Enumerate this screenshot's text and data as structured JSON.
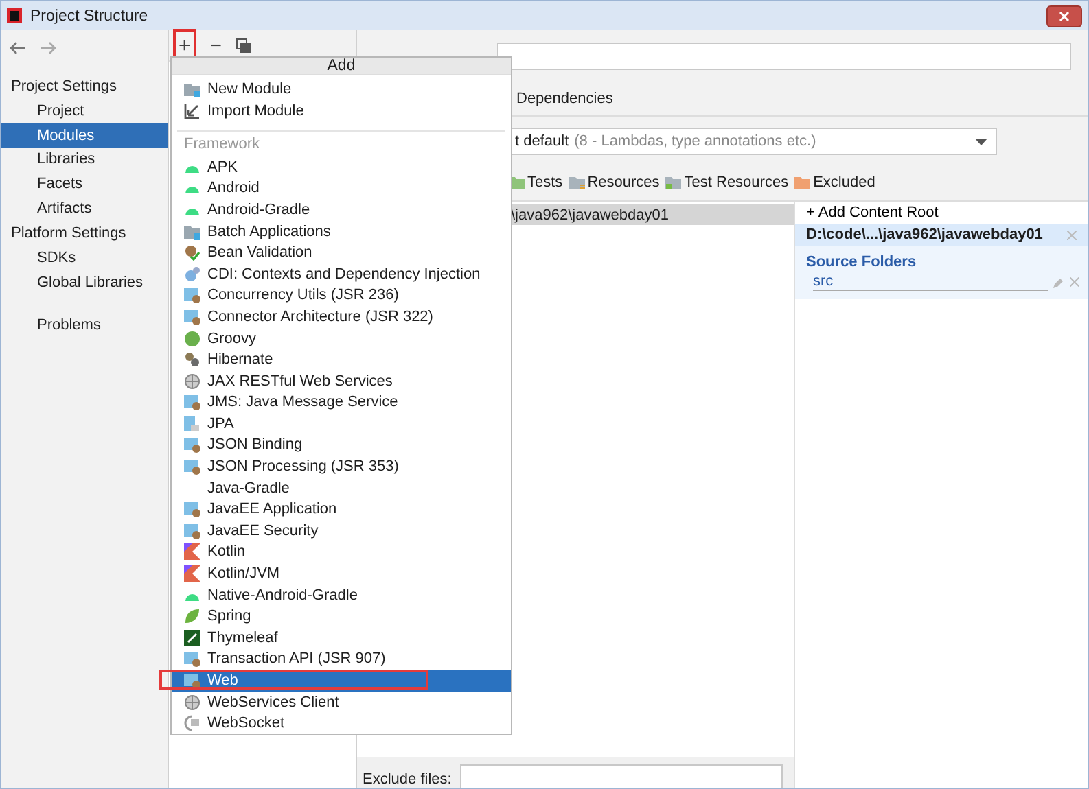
{
  "window": {
    "title": "Project Structure"
  },
  "sidebar": {
    "sections": [
      {
        "title": "Project Settings",
        "items": [
          {
            "label": "Project",
            "selected": false
          },
          {
            "label": "Modules",
            "selected": true
          },
          {
            "label": "Libraries",
            "selected": false
          },
          {
            "label": "Facets",
            "selected": false
          },
          {
            "label": "Artifacts",
            "selected": false
          }
        ]
      },
      {
        "title": "Platform Settings",
        "items": [
          {
            "label": "SDKs",
            "selected": false
          },
          {
            "label": "Global Libraries",
            "selected": false
          }
        ]
      },
      {
        "items": [
          {
            "label": "Problems",
            "selected": false
          }
        ]
      }
    ]
  },
  "toolbar": {
    "add": {
      "symbol": "+",
      "highlighted": true
    },
    "remove": {
      "symbol": "−"
    }
  },
  "module": {
    "tab": "Dependencies",
    "language_level": "t default",
    "language_level_hint": "(8 - Lambdas, type annotations etc.)",
    "mark_as": [
      {
        "label": "Tests",
        "kind": "tests"
      },
      {
        "label": "Resources",
        "kind": "resources"
      },
      {
        "label": "Test Resources",
        "kind": "testres"
      },
      {
        "label": "Excluded",
        "kind": "excluded"
      }
    ],
    "root_path": "\\java962\\javawebday01",
    "exclude_label": "Exclude files:"
  },
  "content_root": {
    "add": "+ Add Content Root",
    "path": "D:\\code\\...\\java962\\javawebday01",
    "source_title": "Source Folders",
    "source": "src"
  },
  "popup": {
    "title": "Add",
    "actions": [
      {
        "label": "New Module",
        "kind": "folder"
      },
      {
        "label": "Import Module",
        "kind": "import"
      }
    ],
    "group": "Framework",
    "items": [
      {
        "label": "APK",
        "kind": "android",
        "selected": false,
        "highlighted": false
      },
      {
        "label": "Android",
        "kind": "android",
        "selected": false,
        "highlighted": false
      },
      {
        "label": "Android-Gradle",
        "kind": "android",
        "selected": false,
        "highlighted": false
      },
      {
        "label": "Batch Applications",
        "kind": "folder",
        "selected": false,
        "highlighted": false
      },
      {
        "label": "Bean Validation",
        "kind": "bean",
        "selected": false,
        "highlighted": false
      },
      {
        "label": "CDI: Contexts and Dependency Injection",
        "kind": "cdi",
        "selected": false,
        "highlighted": false
      },
      {
        "label": "Concurrency Utils (JSR 236)",
        "kind": "module",
        "selected": false,
        "highlighted": false
      },
      {
        "label": "Connector Architecture (JSR 322)",
        "kind": "module",
        "selected": false,
        "highlighted": false
      },
      {
        "label": "Groovy",
        "kind": "groovy",
        "selected": false,
        "highlighted": false
      },
      {
        "label": "Hibernate",
        "kind": "hibernate",
        "selected": false,
        "highlighted": false
      },
      {
        "label": "JAX RESTful Web Services",
        "kind": "globe",
        "selected": false,
        "highlighted": false
      },
      {
        "label": "JMS: Java Message Service",
        "kind": "module",
        "selected": false,
        "highlighted": false
      },
      {
        "label": "JPA",
        "kind": "jpa",
        "selected": false,
        "highlighted": false
      },
      {
        "label": "JSON Binding",
        "kind": "module",
        "selected": false,
        "highlighted": false
      },
      {
        "label": "JSON Processing (JSR 353)",
        "kind": "module",
        "selected": false,
        "highlighted": false
      },
      {
        "label": "Java-Gradle",
        "kind": "none",
        "selected": false,
        "highlighted": false
      },
      {
        "label": "JavaEE Application",
        "kind": "module",
        "selected": false,
        "highlighted": false
      },
      {
        "label": "JavaEE Security",
        "kind": "module",
        "selected": false,
        "highlighted": false
      },
      {
        "label": "Kotlin",
        "kind": "kotlin",
        "selected": false,
        "highlighted": false
      },
      {
        "label": "Kotlin/JVM",
        "kind": "kotlin",
        "selected": false,
        "highlighted": false
      },
      {
        "label": "Native-Android-Gradle",
        "kind": "android",
        "selected": false,
        "highlighted": false
      },
      {
        "label": "Spring",
        "kind": "leaf",
        "selected": false,
        "highlighted": false
      },
      {
        "label": "Thymeleaf",
        "kind": "thymeleaf",
        "selected": false,
        "highlighted": false
      },
      {
        "label": "Transaction API (JSR 907)",
        "kind": "module",
        "selected": false,
        "highlighted": false
      },
      {
        "label": "Web",
        "kind": "module",
        "selected": true,
        "highlighted": true
      },
      {
        "label": "WebServices Client",
        "kind": "globe",
        "selected": false,
        "highlighted": false
      },
      {
        "label": "WebSocket",
        "kind": "socket",
        "selected": false,
        "highlighted": false
      }
    ]
  }
}
